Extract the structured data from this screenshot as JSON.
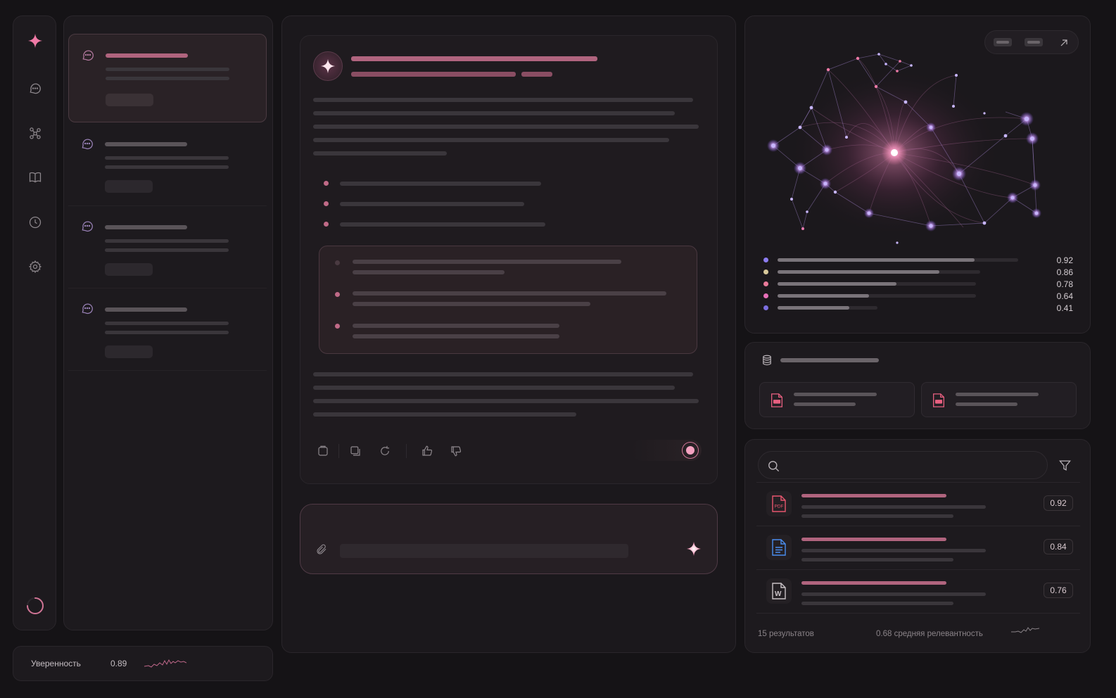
{
  "confidence": {
    "label": "Уверенность",
    "value": "0.89"
  },
  "graph": {
    "legend": [
      {
        "color": "#8c7cf0",
        "value": "0.92",
        "fraction": 0.82
      },
      {
        "color": "#d8c89a",
        "value": "0.86",
        "fraction": 0.8
      },
      {
        "color": "#e97a9a",
        "value": "0.78",
        "fraction": 0.6
      },
      {
        "color": "#e76fb8",
        "value": "0.64",
        "fraction": 0.46
      },
      {
        "color": "#7c6ee0",
        "value": "0.41",
        "fraction": 0.72
      }
    ]
  },
  "results": {
    "items": [
      {
        "type": "pdf",
        "score": "0.92"
      },
      {
        "type": "doc",
        "score": "0.84"
      },
      {
        "type": "word",
        "score": "0.76",
        "icon_letter": "W"
      }
    ],
    "footer_count": "15 результатов",
    "footer_relevance": "0.68 средняя релевантность"
  },
  "source_cards": [
    {
      "type": "pdf"
    },
    {
      "type": "pdf"
    }
  ],
  "colors": {
    "accent": "#f07aa6",
    "panel": "#1d1a1e",
    "background": "#151316"
  },
  "icons": {
    "rail": [
      "sparkle-icon",
      "chat-icon",
      "graph-icon",
      "book-icon",
      "history-icon",
      "settings-icon",
      "loading-icon"
    ],
    "toolbar": [
      "copy-icon",
      "duplicate-icon",
      "refresh-icon",
      "thumbs-up-icon",
      "thumbs-down-icon"
    ]
  }
}
